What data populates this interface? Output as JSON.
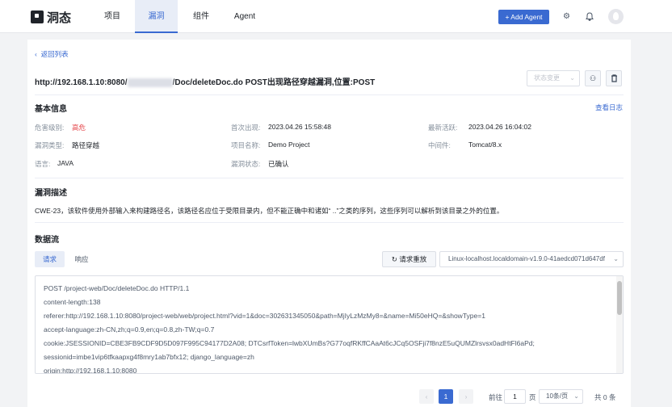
{
  "colors": {
    "brand": "#3a6ad1",
    "danger": "#e5484d",
    "page_bg": "#f2f3f5"
  },
  "header": {
    "logo_text": "洞态",
    "nav": [
      "项目",
      "漏洞",
      "组件",
      "Agent"
    ],
    "active_nav": "漏洞",
    "add_agent_label": "+ Add Agent",
    "icons": [
      "gear-icon",
      "bell-icon",
      "avatar"
    ]
  },
  "detail": {
    "back_label": "返回列表",
    "title_prefix": "http://192.168.1.10:8080/",
    "title_masked_host": "project-web",
    "title_suffix": "/Doc/deleteDoc.do POST出现路径穿越漏洞,位置:POST",
    "status_placeholder": "状态变更",
    "basic_info_title": "基本信息",
    "view_log_label": "查看日志",
    "info": {
      "level_label": "危害级别:",
      "level_value": "高危",
      "first_seen_label": "首次出现:",
      "first_seen_value": "2023.04.26 15:58:48",
      "latest_label": "最新活跃:",
      "latest_value": "2023.04.26 16:04:02",
      "type_label": "漏洞类型:",
      "type_value": "路径穿越",
      "project_label": "项目名称:",
      "project_value": "Demo Project",
      "middleware_label": "中间件:",
      "middleware_value": "Tomcat/8.x",
      "language_label": "语言:",
      "language_value": "JAVA",
      "state_label": "漏洞状态:",
      "state_value": "已确认"
    },
    "desc_title": "漏洞描述",
    "desc_text": "CWE-23，该软件使用外部输入来构建路径名，该路径名应位于受限目录内，但不能正确中和诸如“ ..”之类的序列，这些序列可以解析到该目录之外的位置。",
    "dataflow_title": "数据流",
    "tabs": {
      "request": "请求",
      "response": "响应"
    },
    "replay_label": "请求重放",
    "agent_value": "Linux-localhost.localdomain-v1.9.0-41aedcd071d647df",
    "code_lines": [
      "POST /project-web/Doc/deleteDoc.do HTTP/1.1",
      "content-length:138",
      "referer:http://192.168.1.10:8080/project-web/web/project.html?vid=1&doc=302631345050&path=MjIyLzMzMy8=&name=Mi50eHQ=&showType=1",
      "accept-language:zh-CN,zh;q=0.9,en;q=0.8,zh-TW;q=0.7",
      "cookie:JSESSIONID=CBE3FB9CDF9D5D097F995C94177D2A08; DTCsrfToken=lwbXUmBs?G77oqfRKffCAaAt6cJCq5OSFji7f8nzE5uQUMZlrsvsx0adHtFl6aPd;",
      "sessionid=imbe1vip6tfkaapxg4f8mry1ab7bfx12; django_language=zh",
      "origin:http://192.168.1.10:8080"
    ],
    "pager": {
      "goto_label": "前往",
      "goto_value": "1",
      "page_unit": "页",
      "size_label": "10条/页",
      "total_label": "共 0 条",
      "current_page": "1"
    }
  }
}
